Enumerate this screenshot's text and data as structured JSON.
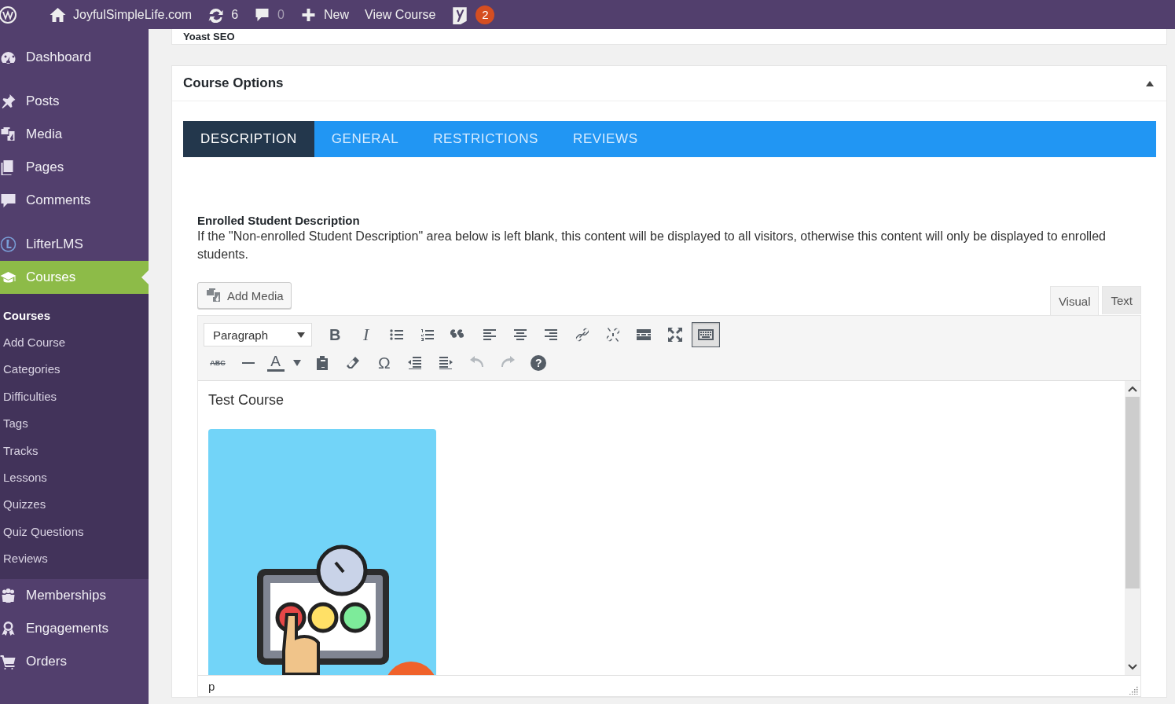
{
  "admin_bar": {
    "site": "JoyfulSimpleLife.com",
    "updates": "6",
    "comments": "0",
    "new": "New",
    "view": "View Course",
    "notifications": "2"
  },
  "sidebar": {
    "groups": [
      {
        "items": [
          {
            "label": "Dashboard",
            "selected": false
          }
        ]
      },
      {
        "items": [
          {
            "label": "Posts",
            "selected": false
          },
          {
            "label": "Media",
            "selected": false
          },
          {
            "label": "Pages",
            "selected": false
          },
          {
            "label": "Comments",
            "selected": false
          }
        ]
      },
      {
        "items": [
          {
            "label": "LifterLMS",
            "selected": false
          },
          {
            "label": "Courses",
            "selected": true,
            "children": [
              {
                "label": "Courses",
                "selected": true
              },
              {
                "label": "Add Course",
                "selected": false
              },
              {
                "label": "Categories",
                "selected": false
              },
              {
                "label": "Difficulties",
                "selected": false
              },
              {
                "label": "Tags",
                "selected": false
              },
              {
                "label": "Tracks",
                "selected": false
              },
              {
                "label": "Lessons",
                "selected": false
              },
              {
                "label": "Quizzes",
                "selected": false
              },
              {
                "label": "Quiz Questions",
                "selected": false
              },
              {
                "label": "Reviews",
                "selected": false
              }
            ]
          },
          {
            "label": "Memberships",
            "selected": false
          },
          {
            "label": "Engagements",
            "selected": false
          },
          {
            "label": "Orders",
            "selected": false
          }
        ]
      }
    ]
  },
  "seo_box": {
    "title": "Yoast SEO"
  },
  "course_options": {
    "title": "Course Options",
    "expanded": true,
    "tabs": [
      {
        "label": "DESCRIPTION",
        "selected": true
      },
      {
        "label": "GENERAL",
        "selected": false
      },
      {
        "label": "RESTRICTIONS",
        "selected": false
      },
      {
        "label": "REVIEWS",
        "selected": false
      }
    ],
    "heading": "Enrolled Student Description",
    "description": "If the \"Non-enrolled Student Description\" area below is left blank, this content will be displayed to all visitors, otherwise this content will only be displayed to enrolled students.",
    "editor": {
      "add_media": "Add Media",
      "modes": [
        {
          "label": "Visual",
          "selected": true
        },
        {
          "label": "Text",
          "selected": false
        }
      ],
      "format": "Paragraph",
      "toolbar_rows": [
        [
          {
            "kind": "bold",
            "glyph": "B"
          },
          {
            "kind": "italic",
            "glyph": "I"
          },
          {
            "kind": "bullets"
          },
          {
            "kind": "numbers"
          },
          {
            "kind": "quote"
          },
          {
            "kind": "align-left"
          },
          {
            "kind": "align-center"
          },
          {
            "kind": "align-right"
          },
          {
            "kind": "link"
          },
          {
            "kind": "unlink"
          },
          {
            "kind": "more"
          },
          {
            "kind": "fullscreen"
          },
          {
            "kind": "toolbar",
            "on": true
          }
        ],
        [
          {
            "kind": "strike",
            "glyph": "ABC"
          },
          {
            "kind": "rule"
          },
          {
            "kind": "text-color",
            "glyph": "A"
          },
          {
            "kind": "paste"
          },
          {
            "kind": "eraser"
          },
          {
            "kind": "symbol",
            "glyph": "Ω"
          },
          {
            "kind": "outdent"
          },
          {
            "kind": "indent"
          },
          {
            "kind": "undo",
            "disabled": true
          },
          {
            "kind": "redo",
            "disabled": true
          },
          {
            "kind": "help",
            "glyph": "?"
          }
        ]
      ],
      "content": {
        "text": "Test Course"
      },
      "path": "p"
    }
  }
}
